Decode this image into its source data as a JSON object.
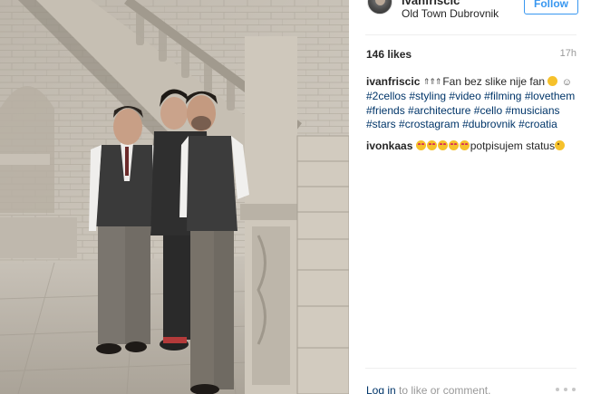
{
  "post": {
    "header": {
      "username": "ivanfriscic",
      "location": "Old Town Dubrovnik",
      "follow_label": "Follow",
      "avatar_icon": "avatar-icon"
    },
    "likes": "146 likes",
    "time": "17h",
    "comments": [
      {
        "user": "ivanfriscic",
        "lead_emoji": "top-arrow-emoji x3",
        "text": "Fan bez slike nije fan",
        "tail_emoji": "smile-emoji",
        "smile_glyph": "☺",
        "hashtags": [
          "#2cellos",
          "#styling",
          "#video",
          "#filming",
          "#lovethem",
          "#friends",
          "#architecture",
          "#cello",
          "#musicians",
          "#stars",
          "#crostagram",
          "#dubrovnik",
          "#croatia"
        ]
      },
      {
        "user": "ivonkaas",
        "lead_emoji": "heart-eyes-emoji x5",
        "text": "potpisujem status",
        "tail_emoji": "wink-emoji"
      }
    ],
    "footer": {
      "login_link": "Log in",
      "login_rest": " to like or comment.",
      "more_icon": "more-options-icon"
    }
  },
  "colors": {
    "link": "#003569",
    "follow": "#3897f0",
    "meta": "#999999",
    "text": "#262626"
  }
}
